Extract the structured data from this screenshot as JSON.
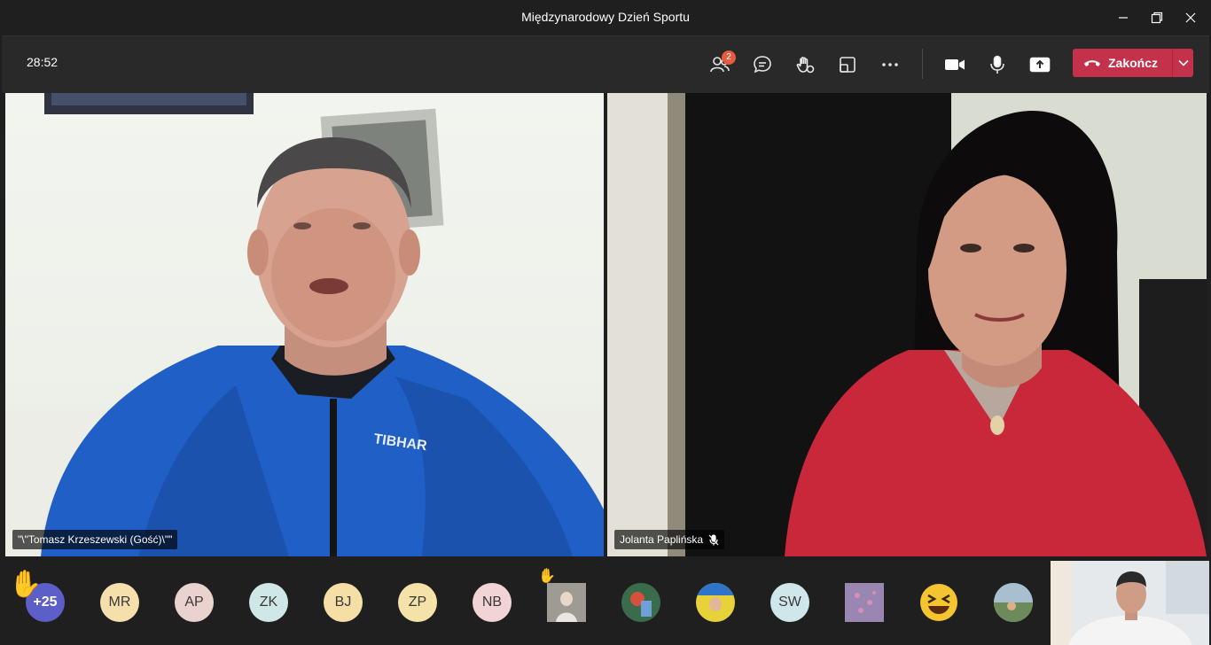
{
  "window": {
    "title": "Międzynarodowy Dzień Sportu"
  },
  "toolbar": {
    "timer": "28:52",
    "participants_badge": "2",
    "end_call_label": "Zakończ"
  },
  "videos": {
    "left": {
      "name": "\"\\\"Tomasz Krzeszewski (Gość)\\\"\""
    },
    "right": {
      "name": "Jolanta Paplińska"
    }
  },
  "participants": {
    "overflow_count": "+25",
    "avatars": [
      {
        "initials": "MR",
        "bg": "#f4dfad"
      },
      {
        "initials": "AP",
        "bg": "#ead2cf"
      },
      {
        "initials": "ZK",
        "bg": "#cfe7e6"
      },
      {
        "initials": "BJ",
        "bg": "#f6dfa7"
      },
      {
        "initials": "ZP",
        "bg": "#f4e2a9"
      },
      {
        "initials": "NB",
        "bg": "#f2d3d6"
      },
      {
        "initials": "SW",
        "bg": "#cfe6ea"
      }
    ]
  },
  "colors": {
    "end_call": "#c4314b",
    "toolbar": "#292929",
    "badge": "#e55b3e"
  }
}
